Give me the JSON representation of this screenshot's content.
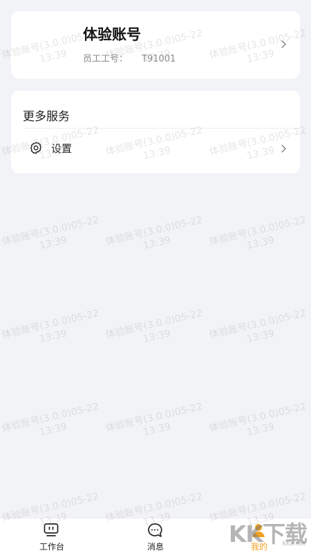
{
  "profile": {
    "name": "体验账号",
    "employee_id_label": "员工工号：",
    "employee_id": "T91001"
  },
  "services": {
    "title": "更多服务",
    "settings_label": "设置"
  },
  "tabbar": {
    "tabs": [
      {
        "label": "工作台",
        "icon": "workbench-icon"
      },
      {
        "label": "消息",
        "icon": "message-icon"
      },
      {
        "label": "我的",
        "icon": "profile-icon"
      }
    ],
    "active_index": 2
  },
  "watermark": {
    "line1": "体验账号(3.0.0)05-22",
    "line2": "13:39"
  },
  "site_badge": {
    "logo": "KK下载",
    "url": "kkx.net"
  },
  "colors": {
    "background": "#f2f3f7",
    "card": "#ffffff",
    "active_tab": "#f2a01f"
  }
}
